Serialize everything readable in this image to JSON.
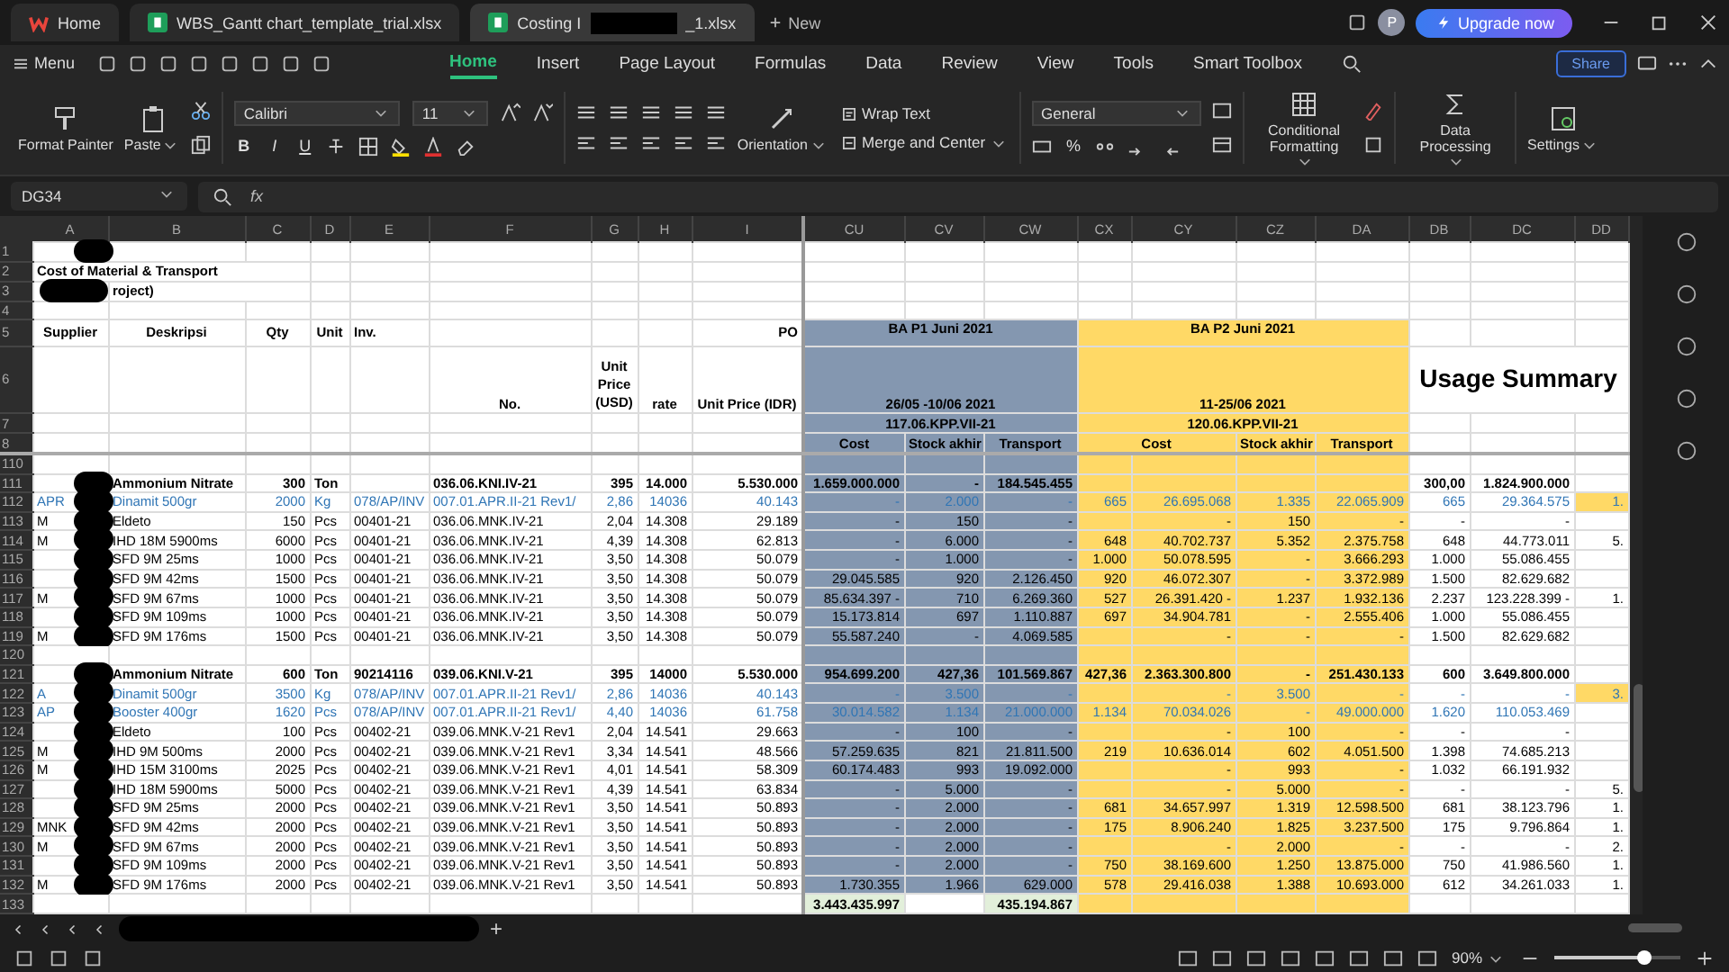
{
  "title_bar": {
    "tabs": [
      {
        "kind": "home",
        "label": "Home",
        "selected": false
      },
      {
        "kind": "sheet",
        "label": "WBS_Gantt chart_template_trial.xlsx",
        "selected": false
      },
      {
        "kind": "sheet",
        "label": "Costing I",
        "label_end": "_1.xlsx",
        "selected": true
      }
    ],
    "new_tab": "New",
    "avatar": "P",
    "upgrade": "Upgrade now"
  },
  "menu": {
    "label": "Menu",
    "tabs": [
      {
        "label": "Home",
        "selected": true
      },
      {
        "label": "Insert",
        "selected": false
      },
      {
        "label": "Page Layout",
        "selected": false
      },
      {
        "label": "Formulas",
        "selected": false
      },
      {
        "label": "Data",
        "selected": false
      },
      {
        "label": "Review",
        "selected": false
      },
      {
        "label": "View",
        "selected": false
      },
      {
        "label": "Tools",
        "selected": false
      },
      {
        "label": "Smart Toolbox",
        "selected": false
      }
    ],
    "share": "Share"
  },
  "ribbon": {
    "format_painter": "Format Painter",
    "paste": "Paste",
    "font": "Calibri",
    "font_size": "11",
    "style_buttons": [
      "B",
      "I",
      "U"
    ],
    "wrap_text": "Wrap Text",
    "orientation": "Orientation",
    "merge": "Merge and Center",
    "number_format": "General",
    "percent": "%",
    "conditional": "Conditional Formatting",
    "data_processing": "Data Processing",
    "settings": "Settings"
  },
  "formula_bar": {
    "cell": "DG34",
    "fx": "fx"
  },
  "sheet": {
    "columns": [
      "A",
      "B",
      "C",
      "D",
      "E",
      "F",
      "G",
      "H",
      "I",
      "CU",
      "CV",
      "CW",
      "CX",
      "CY",
      "CZ",
      "DA",
      "DB",
      "DC",
      "DD"
    ],
    "header_rows": [
      "1",
      "2",
      "3",
      "4",
      "5",
      "6",
      "7",
      "8"
    ],
    "title": "Cost of Material & Transport",
    "subtitle": "roject)",
    "labels": {
      "supplier": "Supplier",
      "deskripsi": "Deskripsi",
      "qty": "Qty",
      "unit": "Unit",
      "inv": "Inv.",
      "po": "PO",
      "no": "No.",
      "usd": "Unit Price (USD)",
      "rate": "rate",
      "idr": "Unit Price (IDR)"
    },
    "periods": [
      {
        "title": "BA P1 Juni 2021",
        "dates": "26/05 -10/06 2021",
        "code": "117.06.KPP.VII-21",
        "cost": "Cost",
        "stock": "Stock akhir",
        "transport": "Transport",
        "color": "#8497b0"
      },
      {
        "title": "BA P2 Juni 2021",
        "dates": "11-25/06 2021",
        "code": "120.06.KPP.VII-21",
        "cost": "Cost",
        "stock": "Stock akhir",
        "transport": "Transport",
        "color": "#ffd966"
      }
    ],
    "summary": "Usage Summary",
    "rows": [
      {
        "num": "110",
        "kind": "blank",
        "redacted": false,
        "flagged": false,
        "cells": []
      },
      {
        "num": "111",
        "kind": "bold",
        "redacted": true,
        "flagged": false,
        "cells": [
          "",
          "Ammonium Nitrate",
          "300",
          "Ton",
          "",
          "036.06.KNI.IV-21",
          "395",
          "14.000",
          "5.530.000",
          "1.659.000.000",
          "-",
          "184.545.455",
          "",
          "",
          "",
          "",
          "300,00",
          "1.824.900.000",
          ""
        ]
      },
      {
        "num": "112",
        "kind": "blue",
        "redacted": true,
        "flagged": true,
        "cells": [
          "APR",
          "Dinamit 500gr",
          "2000",
          "Kg",
          "078/AP/INV",
          "007.01.APR.II-21 Rev1/",
          "2,86",
          "14036",
          "40.143",
          "-",
          "2.000",
          "-",
          "665",
          "26.695.068",
          "1.335",
          "22.065.909",
          "665",
          "29.364.575",
          "1."
        ]
      },
      {
        "num": "113",
        "kind": "plain",
        "redacted": true,
        "flagged": false,
        "cells": [
          "M",
          "Eldeto",
          "150",
          "Pcs",
          "00401-21",
          "036.06.MNK.IV-21",
          "2,04",
          "14.308",
          "29.189",
          "-",
          "150",
          "-",
          "",
          "-",
          "150",
          "-",
          "-",
          "-",
          ""
        ]
      },
      {
        "num": "114",
        "kind": "plain",
        "redacted": true,
        "flagged": false,
        "cells": [
          "M",
          "IHD 18M 5900ms",
          "6000",
          "Pcs",
          "00401-21",
          "036.06.MNK.IV-21",
          "4,39",
          "14.308",
          "62.813",
          "-",
          "6.000",
          "-",
          "648",
          "40.702.737",
          "5.352",
          "2.375.758",
          "648",
          "44.773.011",
          "5."
        ]
      },
      {
        "num": "115",
        "kind": "plain",
        "redacted": true,
        "flagged": false,
        "cells": [
          "",
          "SFD 9M 25ms",
          "1000",
          "Pcs",
          "00401-21",
          "036.06.MNK.IV-21",
          "3,50",
          "14.308",
          "50.079",
          "-",
          "1.000",
          "-",
          "1.000",
          "50.078.595",
          "-",
          "3.666.293",
          "1.000",
          "55.086.455",
          ""
        ]
      },
      {
        "num": "116",
        "kind": "plain",
        "redacted": true,
        "flagged": false,
        "cells": [
          "",
          "SFD 9M 42ms",
          "1500",
          "Pcs",
          "00401-21",
          "036.06.MNK.IV-21",
          "3,50",
          "14.308",
          "50.079",
          "29.045.585",
          "920",
          "2.126.450",
          "920",
          "46.072.307",
          "-",
          "3.372.989",
          "1.500",
          "82.629.682",
          ""
        ]
      },
      {
        "num": "117",
        "kind": "plain",
        "redacted": true,
        "flagged": false,
        "cells": [
          "M",
          "SFD 9M 67ms",
          "1000",
          "Pcs",
          "00401-21",
          "036.06.MNK.IV-21",
          "3,50",
          "14.308",
          "50.079",
          "85.634.397 -",
          "710",
          "6.269.360",
          "527",
          "26.391.420 -",
          "1.237",
          "1.932.136",
          "2.237",
          "123.228.399 -",
          "1."
        ]
      },
      {
        "num": "118",
        "kind": "plain",
        "redacted": true,
        "flagged": false,
        "cells": [
          "",
          "SFD 9M 109ms",
          "1000",
          "Pcs",
          "00401-21",
          "036.06.MNK.IV-21",
          "3,50",
          "14.308",
          "50.079",
          "15.173.814",
          "697",
          "1.110.887",
          "697",
          "34.904.781",
          "-",
          "2.555.406",
          "1.000",
          "55.086.455",
          ""
        ]
      },
      {
        "num": "119",
        "kind": "plain",
        "redacted": true,
        "flagged": false,
        "cells": [
          "M",
          "SFD 9M 176ms",
          "1500",
          "Pcs",
          "00401-21",
          "036.06.MNK.IV-21",
          "3,50",
          "14.308",
          "50.079",
          "55.587.240",
          "-",
          "4.069.585",
          "",
          "-",
          "-",
          "-",
          "1.500",
          "82.629.682",
          ""
        ]
      },
      {
        "num": "120",
        "kind": "blank",
        "redacted": false,
        "flagged": false,
        "cells": []
      },
      {
        "num": "121",
        "kind": "bold",
        "redacted": true,
        "flagged": false,
        "cells": [
          "",
          "Ammonium Nitrate",
          "600",
          "Ton",
          "90214116",
          "039.06.KNI.V-21",
          "395",
          "14000",
          "5.530.000",
          "954.699.200",
          "427,36",
          "101.569.867",
          "427,36",
          "2.363.300.800",
          "-",
          "251.430.133",
          "600",
          "3.649.800.000",
          ""
        ]
      },
      {
        "num": "122",
        "kind": "blue",
        "redacted": true,
        "flagged": true,
        "cells": [
          "A",
          "Dinamit 500gr",
          "3500",
          "Kg",
          "078/AP/INV",
          "007.01.APR.II-21 Rev1/",
          "2,86",
          "14036",
          "40.143",
          "-",
          "3.500",
          "-",
          "",
          "-",
          "3.500",
          "-",
          "-",
          "-",
          "3."
        ]
      },
      {
        "num": "123",
        "kind": "blue",
        "redacted": true,
        "flagged": false,
        "cells": [
          "AP",
          "Booster 400gr",
          "1620",
          "Pcs",
          "078/AP/INV",
          "007.01.APR.II-21 Rev1/",
          "4,40",
          "14036",
          "61.758",
          "30.014.582",
          "1.134",
          "21.000.000",
          "1.134",
          "70.034.026",
          "-",
          "49.000.000",
          "1.620",
          "110.053.469",
          ""
        ]
      },
      {
        "num": "124",
        "kind": "plain",
        "redacted": true,
        "flagged": false,
        "cells": [
          "",
          "Eldeto",
          "100",
          "Pcs",
          "00402-21",
          "039.06.MNK.V-21 Rev1",
          "2,04",
          "14.541",
          "29.663",
          "-",
          "100",
          "-",
          "",
          "-",
          "100",
          "-",
          "-",
          "-",
          ""
        ]
      },
      {
        "num": "125",
        "kind": "plain",
        "redacted": true,
        "flagged": false,
        "cells": [
          "M",
          "IHD 9M 500ms",
          "2000",
          "Pcs",
          "00402-21",
          "039.06.MNK.V-21 Rev1",
          "3,34",
          "14.541",
          "48.566",
          "57.259.635",
          "821",
          "21.811.500",
          "219",
          "10.636.014",
          "602",
          "4.051.500",
          "1.398",
          "74.685.213",
          ""
        ]
      },
      {
        "num": "126",
        "kind": "plain",
        "redacted": true,
        "flagged": false,
        "cells": [
          "M",
          "IHD 15M 3100ms",
          "2025",
          "Pcs",
          "00402-21",
          "039.06.MNK.V-21 Rev1",
          "4,01",
          "14.541",
          "58.309",
          "60.174.483",
          "993",
          "19.092.000",
          "",
          "-",
          "993",
          "-",
          "1.032",
          "66.191.932",
          ""
        ]
      },
      {
        "num": "127",
        "kind": "plain",
        "redacted": true,
        "flagged": false,
        "cells": [
          "",
          "IHD 18M 5900ms",
          "5000",
          "Pcs",
          "00402-21",
          "039.06.MNK.V-21 Rev1",
          "4,39",
          "14.541",
          "63.834",
          "-",
          "5.000",
          "-",
          "",
          "-",
          "5.000",
          "-",
          "-",
          "-",
          "5."
        ]
      },
      {
        "num": "128",
        "kind": "plain",
        "redacted": true,
        "flagged": false,
        "cells": [
          "",
          "SFD 9M 25ms",
          "2000",
          "Pcs",
          "00402-21",
          "039.06.MNK.V-21 Rev1",
          "3,50",
          "14.541",
          "50.893",
          "-",
          "2.000",
          "-",
          "681",
          "34.657.997",
          "1.319",
          "12.598.500",
          "681",
          "38.123.796",
          "1."
        ]
      },
      {
        "num": "129",
        "kind": "plain",
        "redacted": true,
        "flagged": false,
        "cells": [
          "MNK",
          "SFD 9M 42ms",
          "2000",
          "Pcs",
          "00402-21",
          "039.06.MNK.V-21 Rev1",
          "3,50",
          "14.541",
          "50.893",
          "-",
          "2.000",
          "-",
          "175",
          "8.906.240",
          "1.825",
          "3.237.500",
          "175",
          "9.796.864",
          "1."
        ]
      },
      {
        "num": "130",
        "kind": "plain",
        "redacted": true,
        "flagged": false,
        "cells": [
          "M",
          "SFD 9M 67ms",
          "2000",
          "Pcs",
          "00402-21",
          "039.06.MNK.V-21 Rev1",
          "3,50",
          "14.541",
          "50.893",
          "-",
          "2.000",
          "-",
          "",
          "-",
          "2.000",
          "-",
          "-",
          "-",
          "2."
        ]
      },
      {
        "num": "131",
        "kind": "plain",
        "redacted": true,
        "flagged": false,
        "cells": [
          "",
          "SFD 9M 109ms",
          "2000",
          "Pcs",
          "00402-21",
          "039.06.MNK.V-21 Rev1",
          "3,50",
          "14.541",
          "50.893",
          "-",
          "2.000",
          "-",
          "750",
          "38.169.600",
          "1.250",
          "13.875.000",
          "750",
          "41.986.560",
          "1."
        ]
      },
      {
        "num": "132",
        "kind": "plain",
        "redacted": true,
        "flagged": false,
        "cells": [
          "M",
          "SFD 9M 176ms",
          "2000",
          "Pcs",
          "00402-21",
          "039.06.MNK.V-21 Rev1",
          "3,50",
          "14.541",
          "50.893",
          "1.730.355",
          "1.966",
          "629.000",
          "578",
          "29.416.038",
          "1.388",
          "10.693.000",
          "612",
          "34.261.033",
          "1."
        ]
      },
      {
        "num": "133",
        "kind": "total",
        "redacted": false,
        "flagged": false,
        "cells": [
          "",
          "",
          "",
          "",
          "",
          "",
          "",
          "",
          "",
          "3.443.435.997",
          "",
          "435.194.867",
          "",
          "",
          "",
          "",
          "",
          "",
          ""
        ]
      }
    ]
  },
  "sheet_tabs": {
    "add": "+"
  },
  "status": {
    "zoom": "90%",
    "zoom_slider": {
      "level": 0.72
    }
  }
}
